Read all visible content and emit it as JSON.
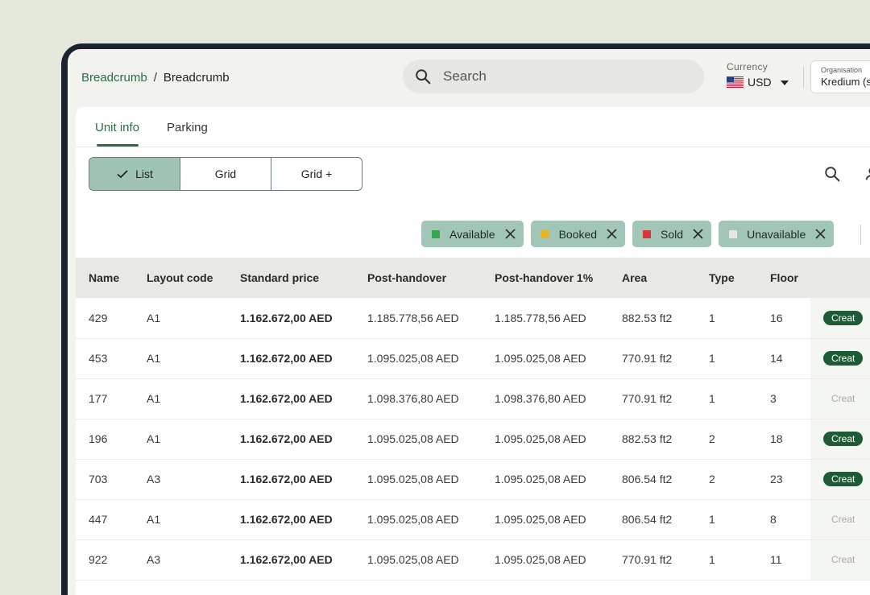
{
  "breadcrumb": {
    "first": "Breadcrumb",
    "separator": "/",
    "second": "Breadcrumb"
  },
  "search": {
    "placeholder": "Search"
  },
  "currency": {
    "label": "Currency",
    "value": "USD"
  },
  "organisation": {
    "label": "Organisation",
    "value": "Kredium (s"
  },
  "tabs": [
    {
      "label": "Unit info",
      "active": true
    },
    {
      "label": "Parking",
      "active": false
    }
  ],
  "view_toggle": {
    "list": "List",
    "grid": "Grid",
    "grid_plus": "Grid +",
    "selected": "List"
  },
  "filters": [
    {
      "label": "Available",
      "color": "#2fa84f"
    },
    {
      "label": "Booked",
      "color": "#e8b422"
    },
    {
      "label": "Sold",
      "color": "#d9343a"
    },
    {
      "label": "Unavailable",
      "color": "#e6e6e6"
    }
  ],
  "table": {
    "columns": [
      "Name",
      "Layout code",
      "Standard price",
      "Post-handover",
      "Post-handover 1%",
      "Area",
      "Type",
      "Floor"
    ],
    "rows": [
      {
        "name": "429",
        "layout": "A1",
        "standard": "1.162.672,00 AED",
        "post": "1.185.778,56 AED",
        "post1": "1.185.778,56 AED",
        "area": "882.53 ft2",
        "type": "1",
        "floor": "16",
        "action": "Creat",
        "enabled": true
      },
      {
        "name": "453",
        "layout": "A1",
        "standard": "1.162.672,00 AED",
        "post": "1.095.025,08 AED",
        "post1": "1.095.025,08 AED",
        "area": "770.91 ft2",
        "type": "1",
        "floor": "14",
        "action": "Creat",
        "enabled": true
      },
      {
        "name": "177",
        "layout": "A1",
        "standard": "1.162.672,00 AED",
        "post": "1.098.376,80 AED",
        "post1": "1.098.376,80 AED",
        "area": "770.91 ft2",
        "type": "1",
        "floor": "3",
        "action": "Creat",
        "enabled": false
      },
      {
        "name": "196",
        "layout": "A1",
        "standard": "1.162.672,00 AED",
        "post": "1.095.025,08 AED",
        "post1": "1.095.025,08 AED",
        "area": "882.53 ft2",
        "type": "2",
        "floor": "18",
        "action": "Creat",
        "enabled": true
      },
      {
        "name": "703",
        "layout": "A3",
        "standard": "1.162.672,00 AED",
        "post": "1.095.025,08 AED",
        "post1": "1.095.025,08 AED",
        "area": "806.54 ft2",
        "type": "2",
        "floor": "23",
        "action": "Creat",
        "enabled": true
      },
      {
        "name": "447",
        "layout": "A1",
        "standard": "1.162.672,00 AED",
        "post": "1.095.025,08 AED",
        "post1": "1.095.025,08 AED",
        "area": "806.54 ft2",
        "type": "1",
        "floor": "8",
        "action": "Creat",
        "enabled": false
      },
      {
        "name": "922",
        "layout": "A3",
        "standard": "1.162.672,00 AED",
        "post": "1.095.025,08 AED",
        "post1": "1.095.025,08 AED",
        "area": "770.91 ft2",
        "type": "1",
        "floor": "11",
        "action": "Creat",
        "enabled": false
      }
    ]
  }
}
